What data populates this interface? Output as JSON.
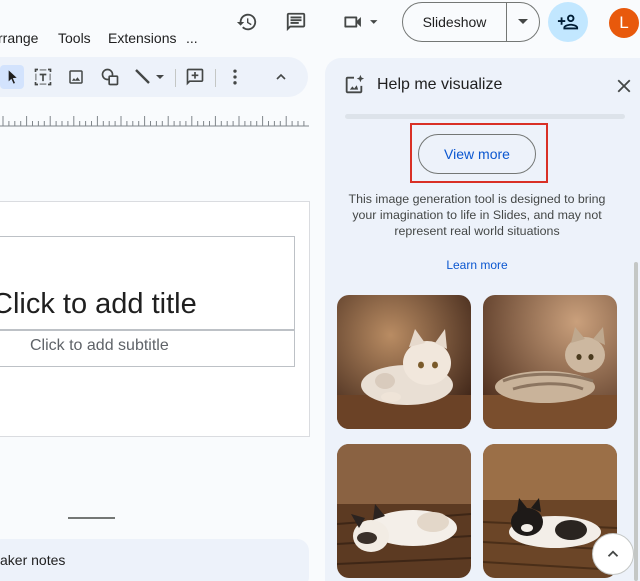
{
  "menu": {
    "items": [
      {
        "label": "rrange"
      },
      {
        "label": "Tools"
      },
      {
        "label": "Extensions"
      },
      {
        "label": "..."
      }
    ]
  },
  "header": {
    "icons": [
      "history-icon",
      "comment-icon",
      "videocam-icon"
    ],
    "slideshow_label": "Slideshow",
    "avatar_initial": "L"
  },
  "slide": {
    "title_placeholder": "Click to add title",
    "subtitle_placeholder": "Click to add subtitle"
  },
  "notes": {
    "label": "aker notes"
  },
  "panel": {
    "title": "Help me visualize",
    "view_more_label": "View more",
    "disclaimer": "This image generation tool is designed to bring your imagination to life in Slides, and may not represent real world situations",
    "learn_more_label": "Learn more",
    "images": [
      {
        "icon": "cat-image-1"
      },
      {
        "icon": "cat-image-2"
      },
      {
        "icon": "cat-image-3"
      },
      {
        "icon": "cat-image-4"
      }
    ]
  },
  "colors": {
    "accent": "#0b57d0",
    "highlight": "#d93025",
    "avatar": "#e8590c",
    "share_bg": "#c2e7ff"
  }
}
